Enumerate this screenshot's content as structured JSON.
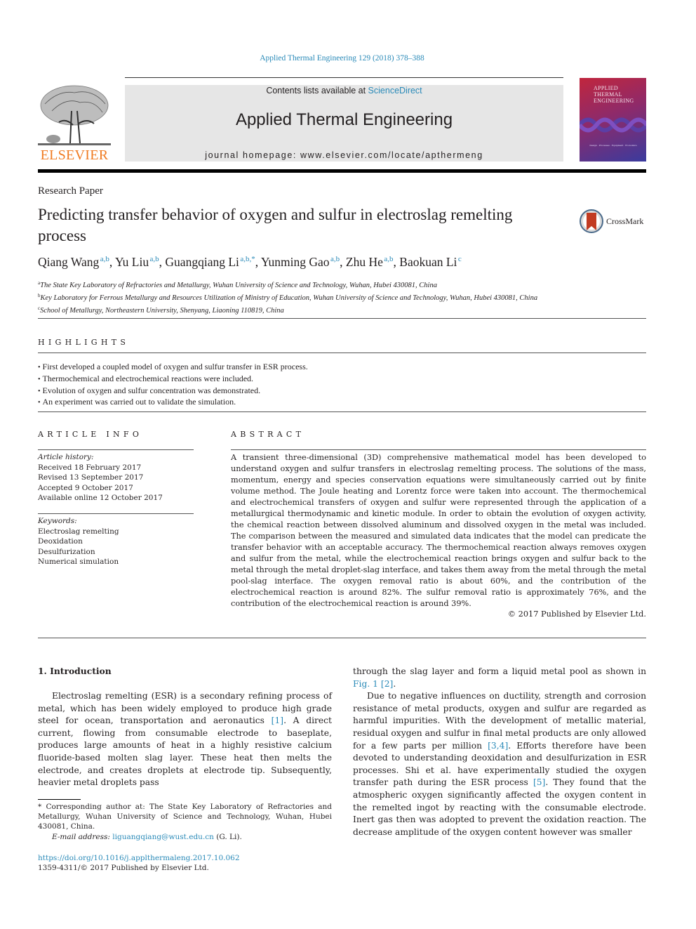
{
  "citation": "Applied Thermal Engineering 129 (2018) 378–388",
  "header": {
    "publisher_logo_text": "ELSEVIER",
    "contents_prefix": "Contents lists available at ",
    "contents_link": "ScienceDirect",
    "journal_name": "Applied Thermal Engineering",
    "homepage_prefix": "journal homepage: ",
    "homepage_url": "www.elsevier.com/locate/apthermeng",
    "cover_title_lines": [
      "Applied",
      "Thermal",
      "Engineering"
    ],
    "cover_subtitle": "Design · Processes · Equipment · Economics"
  },
  "article": {
    "type": "Research Paper",
    "title": "Predicting transfer behavior of oxygen and sulfur in electroslag remelting process",
    "crossmark_label": "CrossMark",
    "authors": [
      {
        "name": "Qiang Wang",
        "sup": "a,b"
      },
      {
        "name": "Yu Liu",
        "sup": "a,b"
      },
      {
        "name": "Guangqiang Li",
        "sup": "a,b,*"
      },
      {
        "name": "Yunming Gao",
        "sup": "a,b"
      },
      {
        "name": "Zhu He",
        "sup": "a,b"
      },
      {
        "name": "Baokuan Li",
        "sup": "c"
      }
    ],
    "affiliations": [
      {
        "key": "a",
        "text": "The State Key Laboratory of Refractories and Metallurgy, Wuhan University of Science and Technology, Wuhan, Hubei 430081, China"
      },
      {
        "key": "b",
        "text": "Key Laboratory for Ferrous Metallurgy and Resources Utilization of Ministry of Education, Wuhan University of Science and Technology, Wuhan, Hubei 430081, China"
      },
      {
        "key": "c",
        "text": "School of Metallurgy, Northeastern University, Shenyang, Liaoning 110819, China"
      }
    ]
  },
  "highlights": {
    "heading": "HIGHLIGHTS",
    "items": [
      "First developed a coupled model of oxygen and sulfur transfer in ESR process.",
      "Thermochemical and electrochemical reactions were included.",
      "Evolution of oxygen and sulfur concentration was demonstrated.",
      "An experiment was carried out to validate the simulation."
    ]
  },
  "article_info": {
    "heading": "ARTICLE INFO",
    "history_label": "Article history:",
    "history": [
      "Received 18 February 2017",
      "Revised 13 September 2017",
      "Accepted 9 October 2017",
      "Available online 12 October 2017"
    ],
    "keywords_label": "Keywords:",
    "keywords": [
      "Electroslag remelting",
      "Deoxidation",
      "Desulfurization",
      "Numerical simulation"
    ]
  },
  "abstract": {
    "heading": "ABSTRACT",
    "text": "A transient three-dimensional (3D) comprehensive mathematical model has been developed to understand oxygen and sulfur transfers in electroslag remelting process. The solutions of the mass, momentum, energy and species conservation equations were simultaneously carried out by finite volume method. The Joule heating and Lorentz force were taken into account. The thermochemical and electrochemical transfers of oxygen and sulfur were represented through the application of a metallurgical thermodynamic and kinetic module. In order to obtain the evolution of oxygen activity, the chemical reaction between dissolved aluminum and dissolved oxygen in the metal was included. The comparison between the measured and simulated data indicates that the model can predicate the transfer behavior with an acceptable accuracy. The thermochemical reaction always removes oxygen and sulfur from the metal, while the electrochemical reaction brings oxygen and sulfur back to the metal through the metal droplet-slag interface, and takes them away from the metal through the metal pool-slag interface. The oxygen removal ratio is about 60%, and the contribution of the electrochemical reaction is around 82%. The sulfur removal ratio is approximately 76%, and the contribution of the electrochemical reaction is around 39%.",
    "copyright": "© 2017 Published by Elsevier Ltd."
  },
  "body": {
    "section_heading": "1. Introduction",
    "col1_p1_a": "Electroslag remelting (ESR) is a secondary refining process of metal, which has been widely employed to produce high grade steel for ocean, transportation and aeronautics ",
    "col1_p1_ref1": "[1]",
    "col1_p1_b": ". A direct current, flowing from consumable electrode to baseplate, produces large amounts of heat in a highly resistive calcium fluoride-based molten slag layer. These heat then melts the electrode, and creates droplets at electrode tip. Subsequently, heavier metal droplets pass",
    "col2_p1_a": "through the slag layer and form a liquid metal pool as shown in ",
    "col2_p1_fig": "Fig. 1",
    "col2_p1_ref2": "[2]",
    "col2_p1_b": ".",
    "col2_p2_a": "Due to negative influences on ductility, strength and corrosion resistance of metal products, oxygen and sulfur are regarded as harmful impurities. With the development of metallic material, residual oxygen and sulfur in final metal products are only allowed for a few parts per million ",
    "col2_p2_ref34": "[3,4]",
    "col2_p2_b": ". Efforts therefore have been devoted to understanding deoxidation and desulfurization in ESR processes. Shi et al. have experimentally studied the oxygen transfer path during the ESR process ",
    "col2_p2_ref5": "[5]",
    "col2_p2_c": ". They found that the atmospheric oxygen significantly affected the oxygen content in the remelted ingot by reacting with the consumable electrode. Inert gas then was adopted to prevent the oxidation reaction. The decrease amplitude of the oxygen content however was smaller"
  },
  "footnote": {
    "corresponding": "* Corresponding author at: The State Key Laboratory of Refractories and Metallurgy, Wuhan University of Science and Technology, Wuhan, Hubei 430081, China.",
    "email_label": "E-mail address: ",
    "email": "liguangqiang@wust.edu.cn",
    "email_suffix": " (G. Li).",
    "doi": "https://doi.org/10.1016/j.applthermaleng.2017.10.062",
    "issn": "1359-4311/© 2017 Published by Elsevier Ltd."
  }
}
